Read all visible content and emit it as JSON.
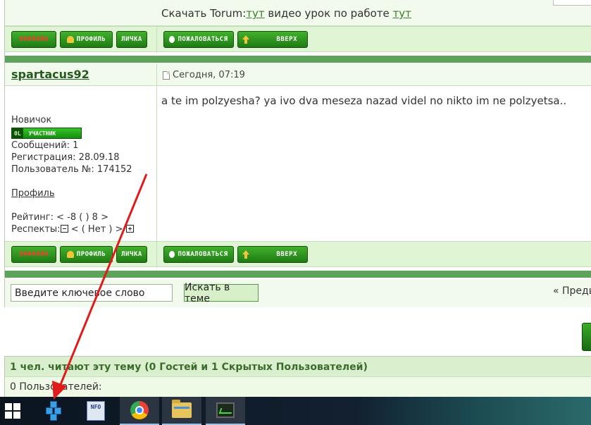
{
  "signature": {
    "prefix": "Скачать Torum:",
    "link1": "тут",
    "middle": " видео урок по работе ",
    "link2": "тут"
  },
  "post_buttons_left": {
    "offline": "оффлайн",
    "profile": "профиль",
    "pm": "личка"
  },
  "post_buttons_right": {
    "report": "пожаловаться",
    "top": "вверх"
  },
  "post": {
    "author": "spartacus92",
    "date": "Сегодня, 07:19",
    "text": "a te im polzyesha? ya ivo dva meseza nazad videl no nikto im ne polzyetsa.."
  },
  "profile": {
    "rank_title": "Новичок",
    "rank_badge_level": "0L",
    "rank_badge_label": "участник",
    "messages": "Сообщений: 1",
    "registration": "Регистрация: 28.09.18",
    "user_number": "Пользователь №: 174152",
    "profile_link": "Профиль",
    "rating": "Рейтинг: < -8 ( ) 8 >",
    "respects_label": "Респекты:",
    "respects_value": " < ( Нет ) > "
  },
  "search": {
    "placeholder": "Введите ключевое слово",
    "button": "Искать в теме",
    "prev": "« Преды"
  },
  "readers": {
    "header": "1 чел. читают эту тему (0 Гостей и 1 Скрытых Пользователей)",
    "users": "0 Пользователей:"
  },
  "taskbar": {
    "items": [
      "start-icon",
      "cubes-app-icon",
      "nfo-viewer-icon",
      "chrome-icon",
      "file-explorer-icon",
      "system-monitor-icon"
    ],
    "nfo_label": "NFO"
  },
  "colors": {
    "accent_green": "#5da45a",
    "button_green": "#1e7b14",
    "link_green": "#3b7d25",
    "annotation_red": "#e01b1b"
  }
}
